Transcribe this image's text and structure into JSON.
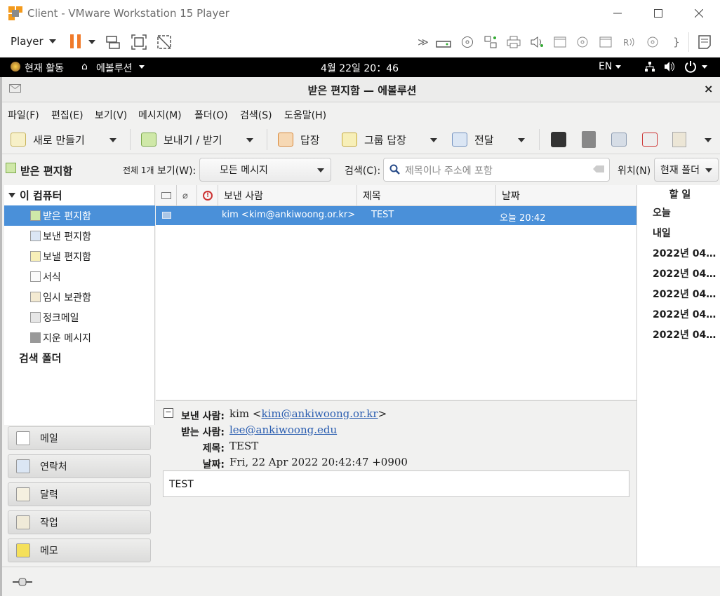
{
  "vmware": {
    "title": "Client - VMware Workstation 15 Player",
    "player_label": "Player",
    "icons": [
      "pause-icon",
      "send-ctrl-alt-del-icon",
      "fit-guest-icon",
      "unity-icon",
      "more-devices-icon",
      "hdd-icon",
      "cd-icon",
      "network-icon",
      "printer-icon",
      "sound-icon",
      "usb-icon",
      "cd2-icon",
      "box-icon",
      "camera-icon",
      "disk-icon",
      "bracket-icon",
      "message-icon"
    ]
  },
  "gnome": {
    "activities": "현재 활동",
    "app_menu": "에볼루션",
    "clock": "4월 22일  20：46",
    "lang": "EN"
  },
  "window": {
    "title": "받은 편지함 — 에볼루션"
  },
  "menu": {
    "file": "파일(F)",
    "edit": "편집(E)",
    "view": "보기(V)",
    "message": "메시지(M)",
    "folder": "폴더(O)",
    "search": "검색(S)",
    "help": "도움말(H)"
  },
  "toolbar": {
    "new": "새로 만들기",
    "send_receive": "보내기 / 받기",
    "reply": "답장",
    "reply_group": "그룹 답장",
    "forward": "전달"
  },
  "filter": {
    "folder_title": "받은 편지함",
    "count": "전체 1개",
    "view_label": "보기(W):",
    "view_value": "모든 메시지",
    "search_label": "검색(C):",
    "search_placeholder": "제목이나 주소에 포함",
    "location_label": "위치(N)",
    "location_value": "현재 폴더"
  },
  "sidebar": {
    "account": "이 컴퓨터",
    "folders": [
      "받은 편지함",
      "보낸 편지함",
      "보낼 편지함",
      "서식",
      "임시 보관함",
      "정크메일",
      "지운 메시지"
    ],
    "search_folders": "검색 폴더"
  },
  "switcher": [
    "메일",
    "연락처",
    "달력",
    "작업",
    "메모"
  ],
  "list": {
    "columns": {
      "from": "보낸 사람",
      "subject": "제목",
      "date": "날짜"
    },
    "rows": [
      {
        "from": "kim <kim@ankiwoong.or.kr>",
        "subject": "TEST",
        "date": "오늘 20:42"
      }
    ]
  },
  "preview": {
    "from_label": "보낸 사람:",
    "from_name": "kim <",
    "from_email": "kim@ankiwoong.or.kr",
    "from_end": ">",
    "to_label": "받는 사람:",
    "to_email": "lee@ankiwoong.edu",
    "subject_label": "제목:",
    "subject": "TEST",
    "date_label": "날짜:",
    "date": "Fri, 22 Apr 2022 20:42:47 +0900",
    "body": "TEST"
  },
  "todo": {
    "title": "할 일",
    "items": [
      "오늘",
      "내일",
      "2022년 04…",
      "2022년 04…",
      "2022년 04…",
      "2022년 04…",
      "2022년 04…"
    ]
  },
  "colors": {
    "selection": "#4a90d9",
    "link": "#2a5db0"
  }
}
